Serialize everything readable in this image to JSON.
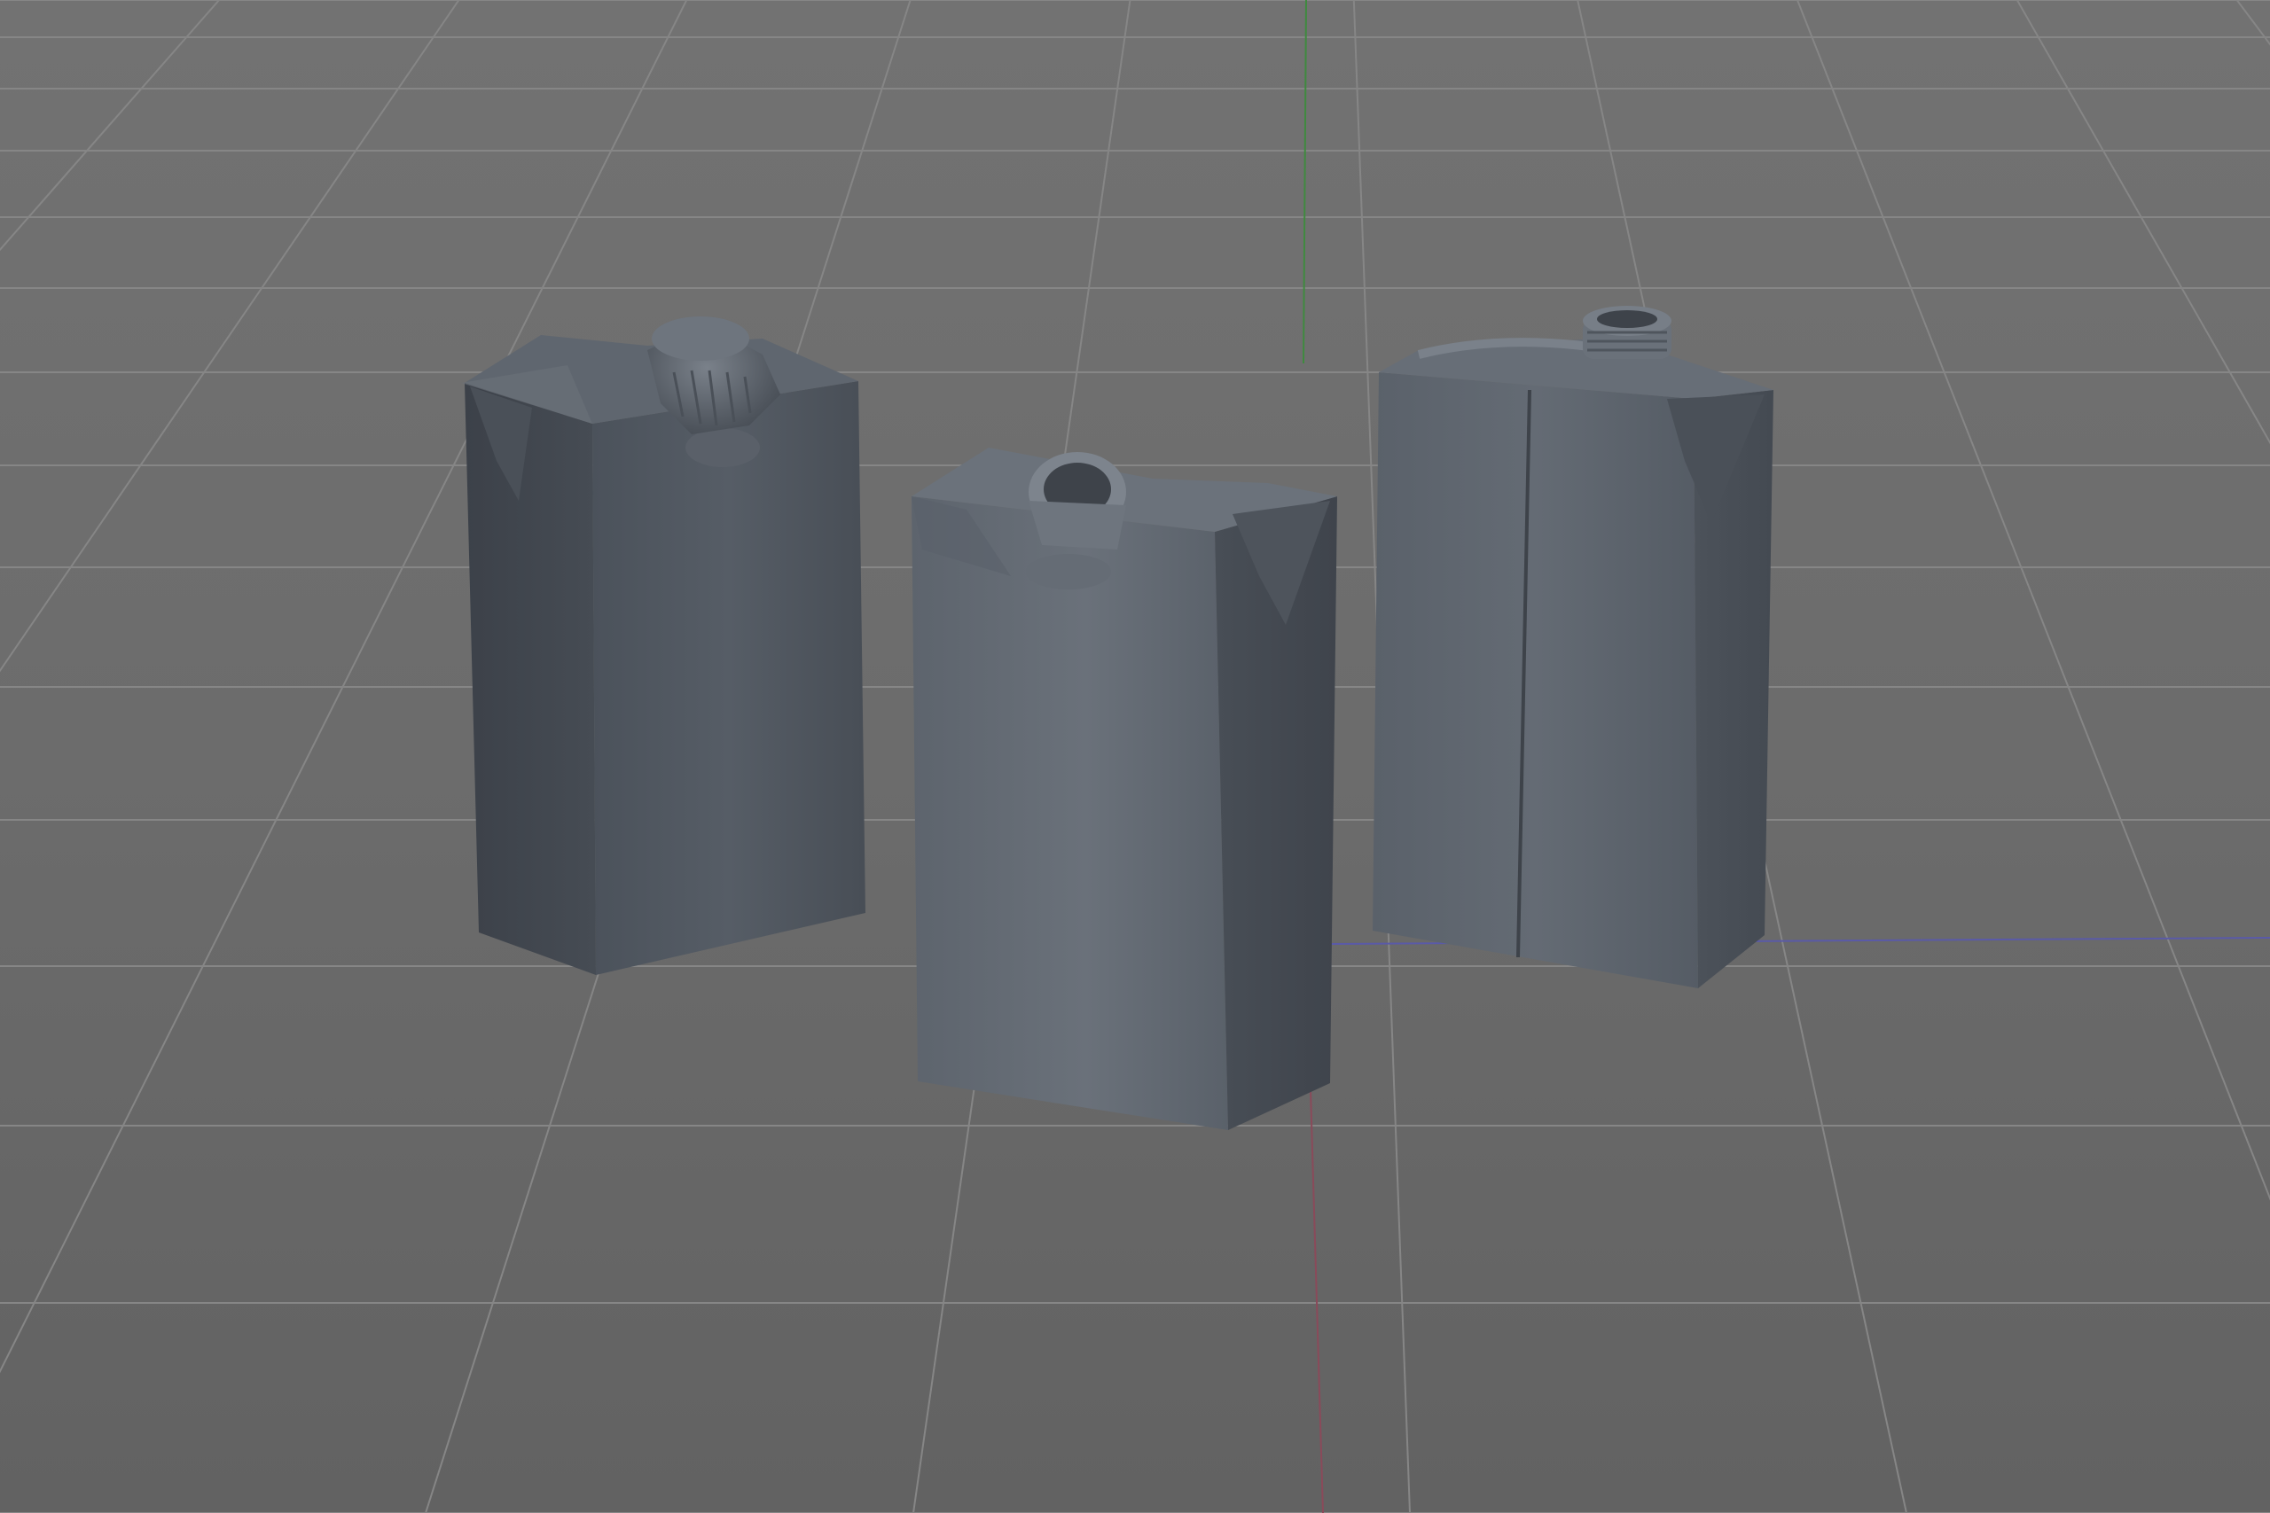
{
  "viewport": {
    "type": "3d-perspective-viewport",
    "background": "#6e6e6e",
    "grid_color": "#868686",
    "axis_colors": {
      "x": "#8a4a5a",
      "y": "#3f8a3f",
      "z": "#5a5aa8"
    },
    "grid": true
  },
  "scene": {
    "objects": [
      {
        "name": "carton-with-cap",
        "material_color": "#555c66",
        "has_cap": true
      },
      {
        "name": "carton-open-spout-front",
        "material_color": "#5f6670",
        "has_cap": false
      },
      {
        "name": "carton-open-spout-back",
        "material_color": "#575e68",
        "has_cap": false
      }
    ]
  }
}
